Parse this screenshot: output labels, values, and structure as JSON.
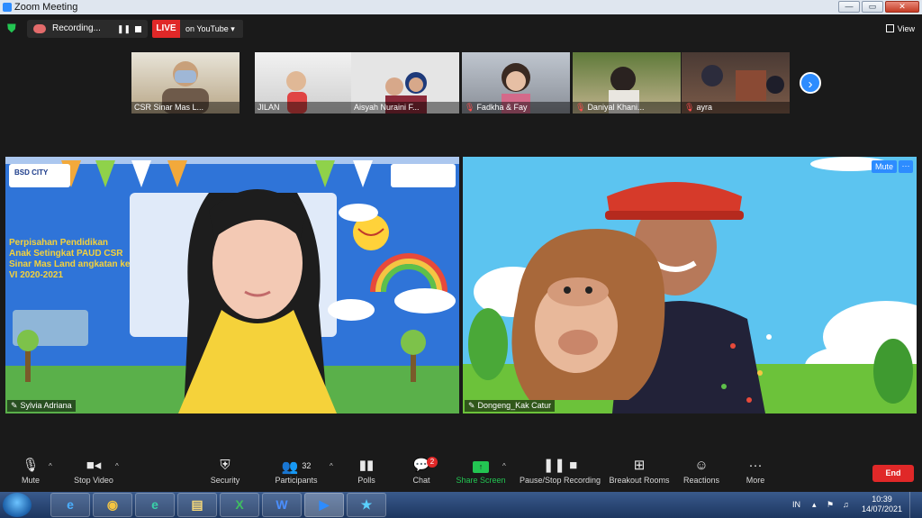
{
  "window": {
    "title": "Zoom Meeting",
    "controls": [
      "—",
      "▭",
      "✕"
    ]
  },
  "topbar": {
    "recording_label": "Recording...",
    "live_label": "LIVE",
    "live_target": "on YouTube ▾",
    "view_label": "View"
  },
  "participants_strip": [
    {
      "name": "CSR Sinar Mas L...",
      "muted": false
    },
    {
      "name": "JILAN",
      "muted": false
    },
    {
      "name": "Aisyah Nuraini F...",
      "muted": false
    },
    {
      "name": "Fadkha & Fay",
      "muted": true
    },
    {
      "name": "Daniyal Khani...",
      "muted": true
    },
    {
      "name": "ayra",
      "muted": true
    }
  ],
  "main_tiles": {
    "left": {
      "name": "Sylvia Adriana",
      "slide_brand": "BSD CITY",
      "slide_text": "Perpisahan Pendidikan Anak Setingkat PAUD CSR Sinar Mas Land angkatan ke VI 2020-2021"
    },
    "right": {
      "name": "Dongeng_Kak Catur",
      "mute_label": "Mute",
      "more_label": "···"
    }
  },
  "toolbar": {
    "mute": "Mute",
    "stop_video": "Stop Video",
    "security": "Security",
    "participants": "Participants",
    "participants_count": "32",
    "polls": "Polls",
    "chat": "Chat",
    "chat_badge": "2",
    "share_screen": "Share Screen",
    "pause_stop_recording": "Pause/Stop Recording",
    "breakout_rooms": "Breakout Rooms",
    "reactions": "Reactions",
    "more": "More",
    "end": "End"
  },
  "taskbar": {
    "language": "IN",
    "time": "10:39",
    "date": "14/07/2021",
    "apps": [
      "e",
      "◉",
      "e",
      "▤",
      "X",
      "W",
      "▶",
      "★"
    ]
  },
  "colors": {
    "accent": "#2d8cff",
    "end_red": "#e02828",
    "share_green": "#23c552"
  }
}
